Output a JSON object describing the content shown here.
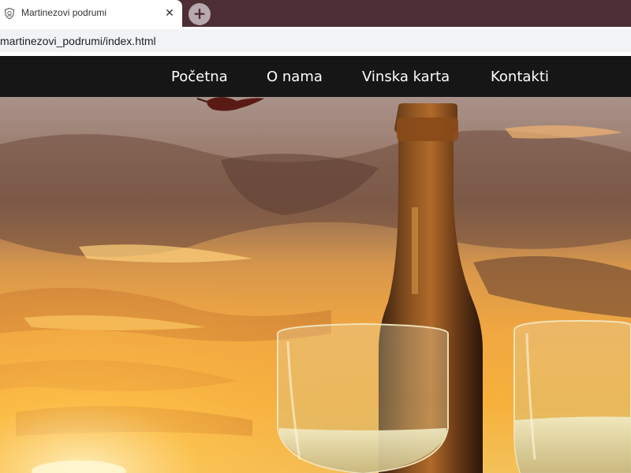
{
  "browser": {
    "tab": {
      "title": "Martinezovi podrumi",
      "favicon_icon": "shield-crest-icon",
      "close_icon": "close-icon",
      "close_symbol": "✕"
    },
    "new_tab": {
      "icon": "plus-icon",
      "symbol": "+"
    },
    "address": {
      "url": "martinezovi_podrumi/index.html"
    },
    "colors": {
      "tabbar": "#4d2e35",
      "tab_active": "#ffffff",
      "address_field": "#f1f3f4"
    }
  },
  "site": {
    "nav": {
      "background": "#161616",
      "items": [
        {
          "label": "Početna"
        },
        {
          "label": "O nama"
        },
        {
          "label": "Vinska karta"
        },
        {
          "label": "Kontakti"
        }
      ]
    },
    "hero": {
      "image": "sunset-sky-wine-bottle-glasses-photo"
    }
  }
}
